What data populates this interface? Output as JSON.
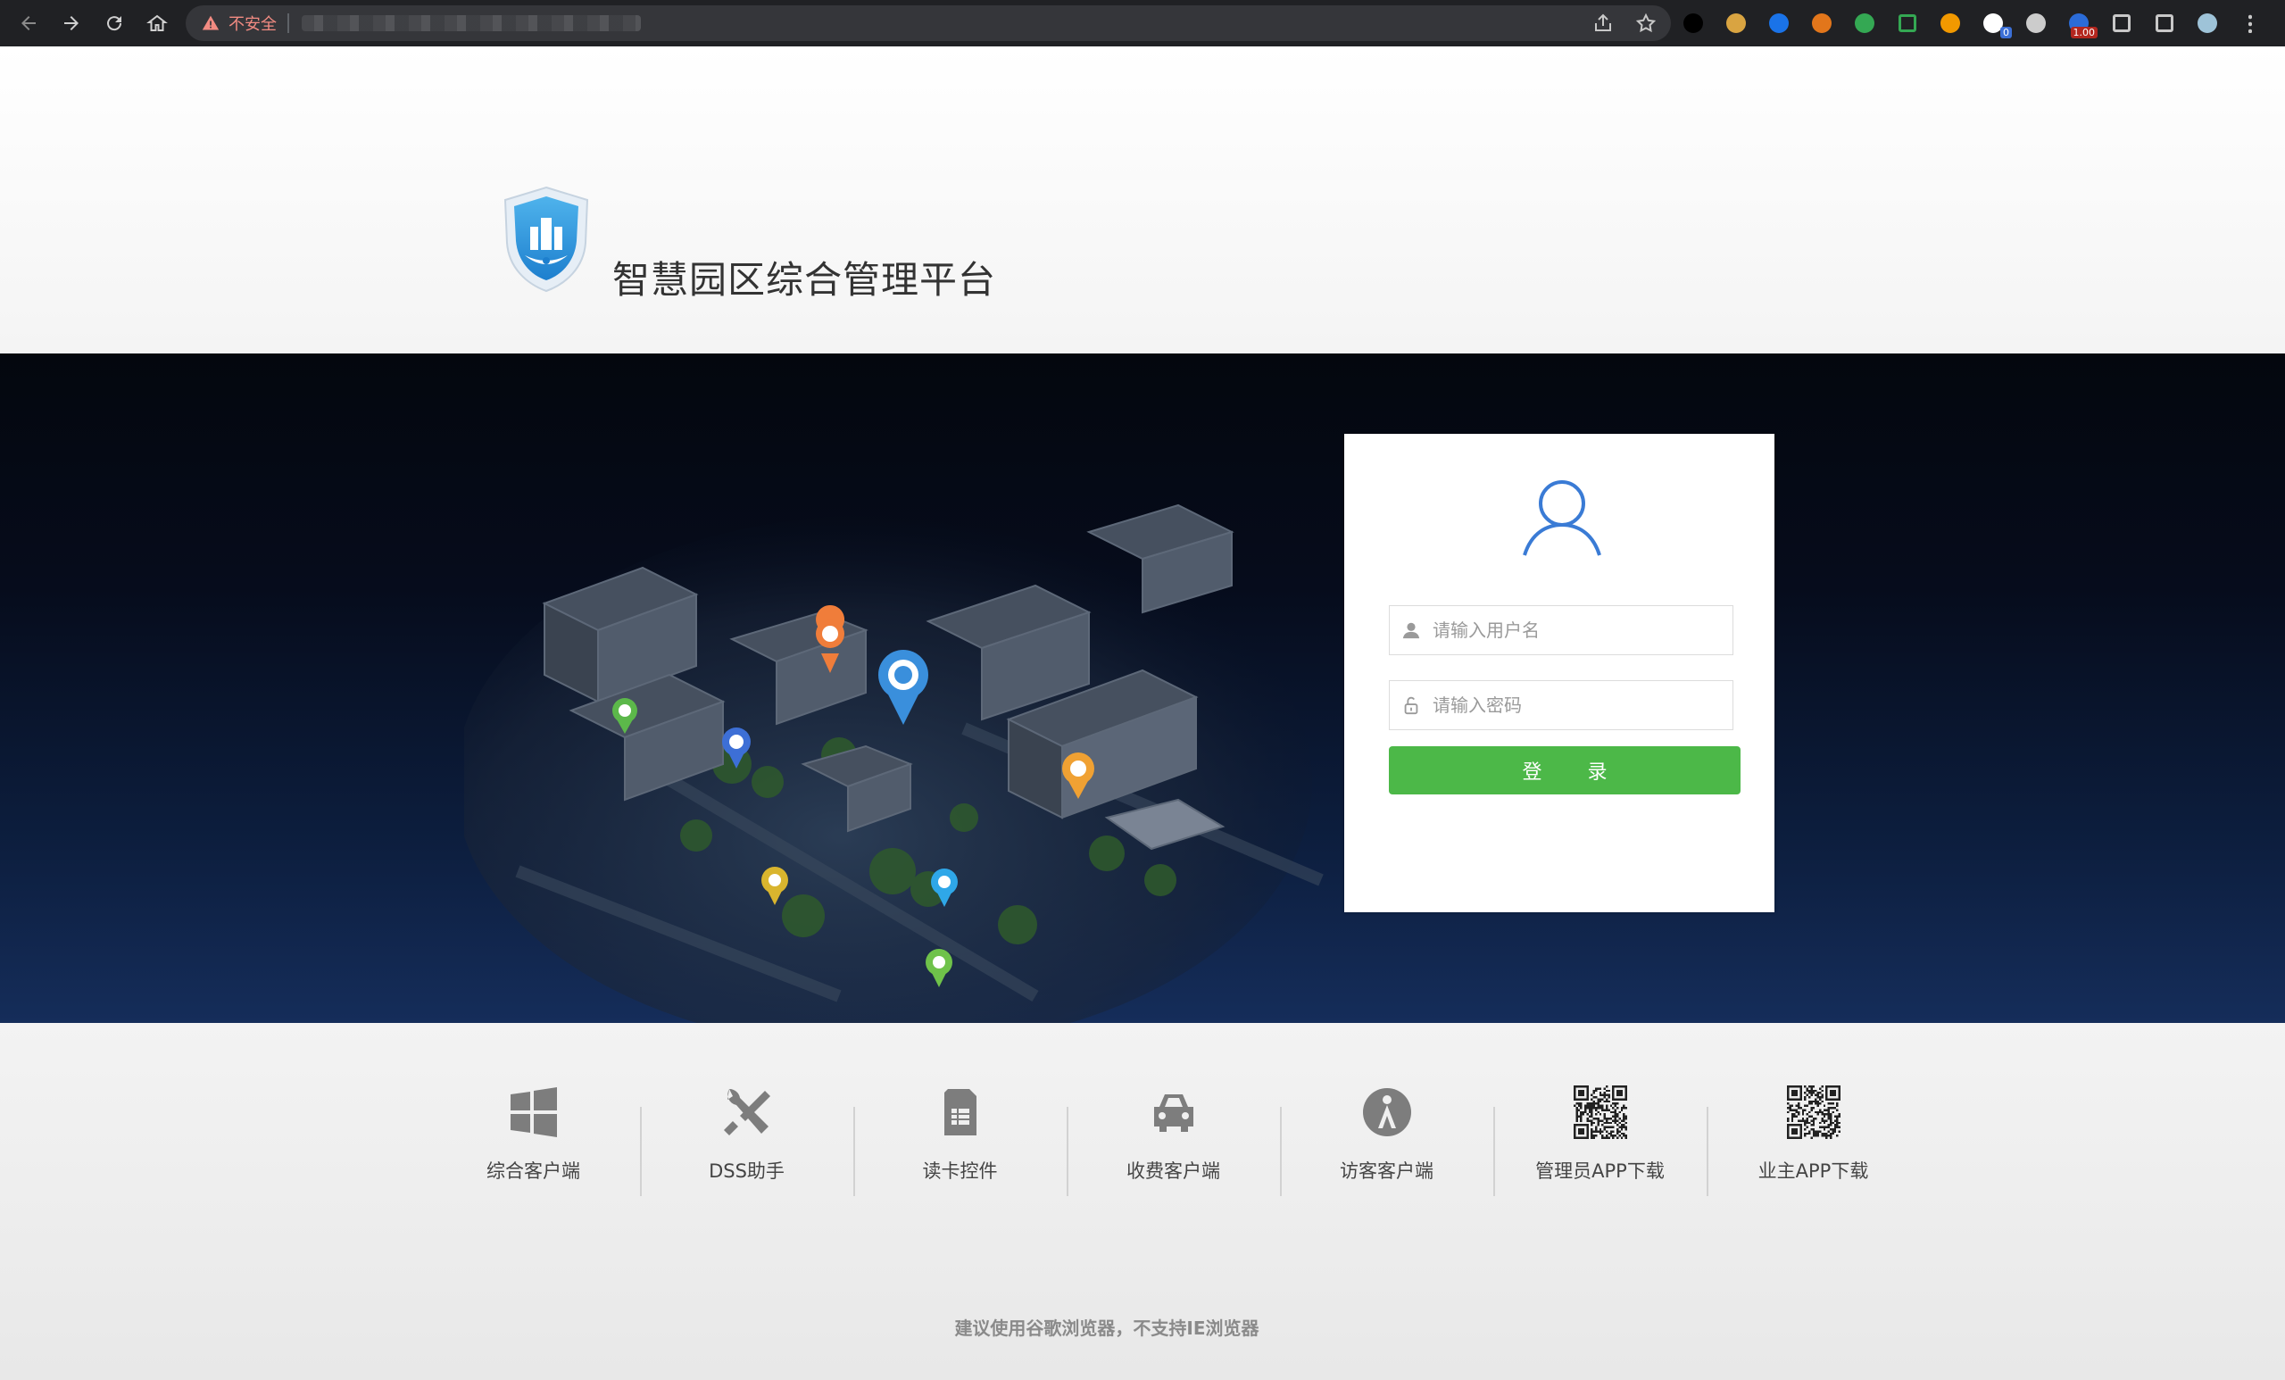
{
  "browser": {
    "security_label": "不安全",
    "extensions": [
      {
        "icon": "circle-dark-ext-icon",
        "color": "#000000"
      },
      {
        "icon": "cookie-ext-icon",
        "color": "#d9a441"
      },
      {
        "icon": "mask-ext-icon",
        "color": "#1a73e8"
      },
      {
        "icon": "metamask-ext-icon",
        "color": "#e2761b"
      },
      {
        "icon": "gear-green-ext-icon",
        "color": "#34a853"
      },
      {
        "icon": "grid-ext-icon",
        "color": "#34a853"
      },
      {
        "icon": "translate-ext-icon",
        "color": "#f29900"
      },
      {
        "icon": "qr-ext-icon",
        "color": "#ffffff",
        "badge": "0"
      },
      {
        "icon": "glasses-ext-icon",
        "color": "#cccccc"
      },
      {
        "icon": "speed-ext-icon",
        "color": "#2b6cd8",
        "badge": "1.00"
      },
      {
        "icon": "puzzle-icon",
        "color": "#c8c8c8"
      },
      {
        "icon": "sidepanel-icon",
        "color": "#c8c8c8"
      },
      {
        "icon": "profile-avatar",
        "color": "#9ec3d8"
      },
      {
        "icon": "kebab-menu-icon",
        "color": "#c8c8c8"
      }
    ]
  },
  "header": {
    "title": "智慧园区综合管理平台",
    "logo_icon": "shield-building-logo"
  },
  "login": {
    "username_placeholder": "请输入用户名",
    "password_placeholder": "请输入密码",
    "submit_label": "登 录",
    "accent": "#4cb848"
  },
  "tools": [
    {
      "icon": "windows-icon",
      "label": "综合客户端"
    },
    {
      "icon": "wrench-screwdriver-icon",
      "label": "DSS助手"
    },
    {
      "icon": "card-reader-icon",
      "label": "读卡控件"
    },
    {
      "icon": "car-icon",
      "label": "收费客户端"
    },
    {
      "icon": "visitor-icon",
      "label": "访客客户端"
    },
    {
      "icon": "qr-code-admin",
      "label": "管理员APP下载"
    },
    {
      "icon": "qr-code-owner",
      "label": "业主APP下载"
    }
  ],
  "footer_notice": "建议使用谷歌浏览器，不支持IE浏览器"
}
